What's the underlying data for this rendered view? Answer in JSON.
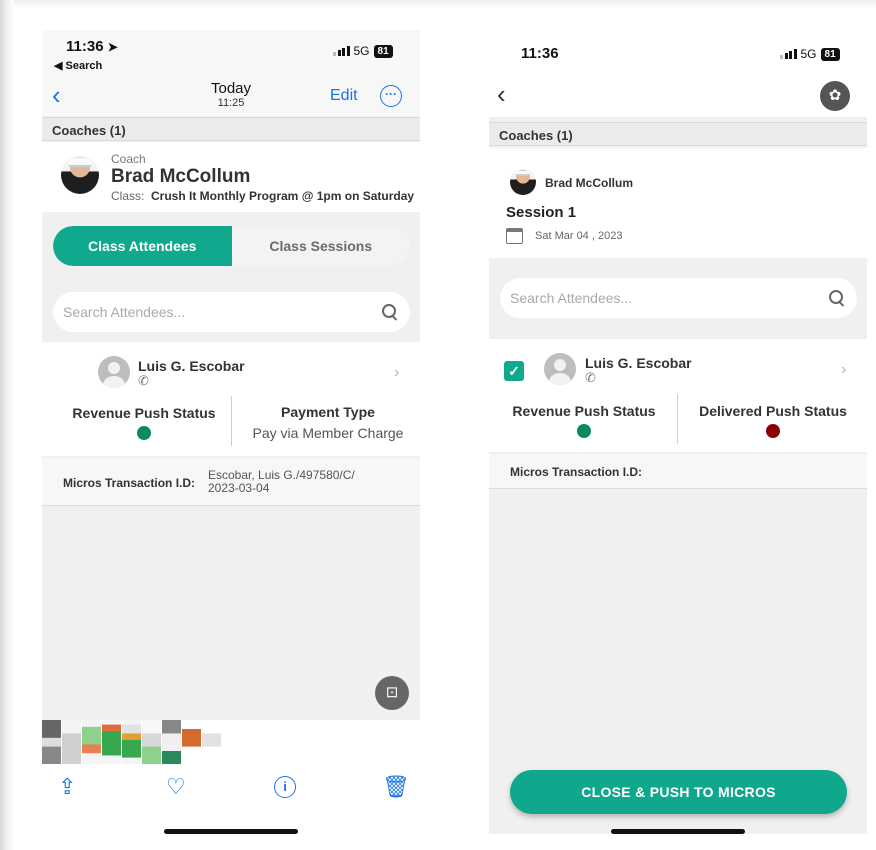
{
  "left": {
    "status": {
      "time": "11:36",
      "back_app": "◀ Search",
      "network": "5G",
      "battery": "81"
    },
    "nav": {
      "title": "Today",
      "subtitle": "11:25",
      "edit_label": "Edit"
    },
    "coaches_header": "Coaches (1)",
    "coach": {
      "role": "Coach",
      "name": "Brad McCollum",
      "class_label": "Class:",
      "class_value": "Crush It Monthly Program @ 1pm on Saturday"
    },
    "tabs": [
      {
        "label": "Class Attendees",
        "active": true
      },
      {
        "label": "Class Sessions",
        "active": false
      }
    ],
    "search": {
      "placeholder": "Search Attendees..."
    },
    "attendee": {
      "name": "Luis G. Escobar",
      "revenue_label": "Revenue Push Status",
      "revenue_status_color": "#0a8a5f",
      "payment_label": "Payment Type",
      "payment_value": "Pay via Member Charge",
      "micros_label": "Micros Transaction I.D:",
      "micros_value_line1": "Escobar, Luis G./497580/C/",
      "micros_value_line2": "2023-03-04"
    },
    "toolbar": {
      "share_icon": "share-icon",
      "favorite_icon": "heart-icon",
      "info_icon": "info-icon",
      "delete_icon": "trash-icon"
    }
  },
  "right": {
    "status": {
      "time": "11:36",
      "network": "5G",
      "battery": "81"
    },
    "coaches_header": "Coaches (1)",
    "coach": {
      "name": "Brad McCollum"
    },
    "session": {
      "title": "Session 1",
      "date": "Sat Mar 04 , 2023"
    },
    "search": {
      "placeholder": "Search Attendees..."
    },
    "attendee": {
      "name": "Luis G. Escobar",
      "checked": true,
      "revenue_label": "Revenue Push Status",
      "revenue_status_color": "#0a8a5f",
      "delivered_label": "Delivered Push Status",
      "delivered_status_color": "#8b0000",
      "micros_label": "Micros Transaction I.D:"
    },
    "cta_label": "CLOSE & PUSH TO MICROS"
  },
  "colors": {
    "accent": "#10a98e",
    "ios_blue": "#1a73e8",
    "status_green": "#0a8a5f",
    "status_red": "#8b0000"
  }
}
